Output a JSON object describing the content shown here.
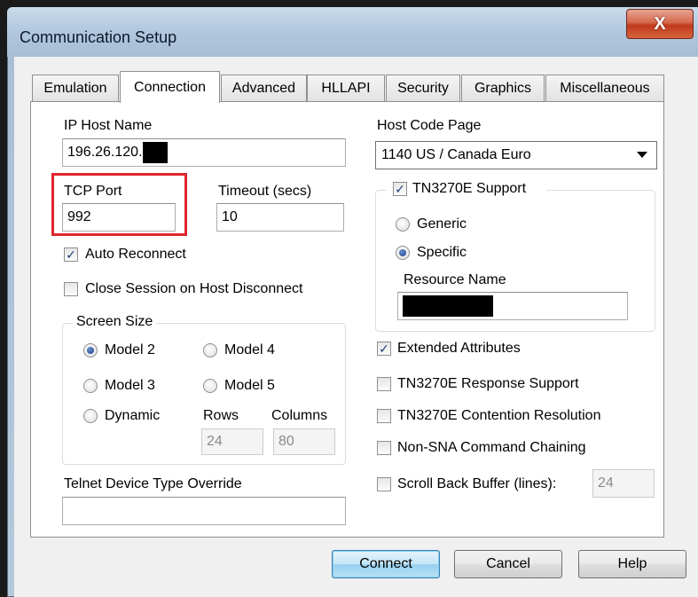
{
  "window": {
    "title": "Communication Setup",
    "close_glyph": "X"
  },
  "tabs": [
    {
      "label": "Emulation"
    },
    {
      "label": "Connection",
      "active": true
    },
    {
      "label": "Advanced"
    },
    {
      "label": "HLLAPI"
    },
    {
      "label": "Security"
    },
    {
      "label": "Graphics"
    },
    {
      "label": "Miscellaneous"
    }
  ],
  "connection": {
    "ip_host_name_label": "IP Host Name",
    "ip_host_name_value": "196.26.120.",
    "tcp_port_label": "TCP Port",
    "tcp_port_value": "992",
    "timeout_label": "Timeout (secs)",
    "timeout_value": "10",
    "auto_reconnect_label": "Auto Reconnect",
    "auto_reconnect_checked": true,
    "close_session_label": "Close Session on Host Disconnect",
    "close_session_checked": false,
    "screen_size": {
      "label": "Screen Size",
      "model2": "Model 2",
      "model3": "Model 3",
      "model4": "Model 4",
      "model5": "Model 5",
      "dynamic": "Dynamic",
      "selected": "Model 2",
      "rows_label": "Rows",
      "rows_value": "24",
      "columns_label": "Columns",
      "columns_value": "80"
    },
    "telnet_label": "Telnet Device Type Override",
    "telnet_value": "",
    "host_code_page_label": "Host Code Page",
    "host_code_page_value": "1140  US / Canada Euro",
    "tn3270e_support_label": "TN3270E Support",
    "tn3270e_support_checked": true,
    "generic_label": "Generic",
    "specific_label": "Specific",
    "tn_mode_selected": "Specific",
    "resource_name_label": "Resource Name",
    "extended_attributes_label": "Extended Attributes",
    "extended_attributes_checked": true,
    "response_support_label": "TN3270E Response Support",
    "contention_label": "TN3270E Contention Resolution",
    "non_sna_label": "Non-SNA Command Chaining",
    "scroll_back_label": "Scroll Back Buffer (lines):",
    "scroll_back_value": "24"
  },
  "buttons": {
    "connect": "Connect",
    "cancel": "Cancel",
    "help": "Help"
  },
  "colors": {
    "highlight": "#e0262e",
    "close_button": "#c0391d",
    "title_bar": "#b1c7de"
  }
}
